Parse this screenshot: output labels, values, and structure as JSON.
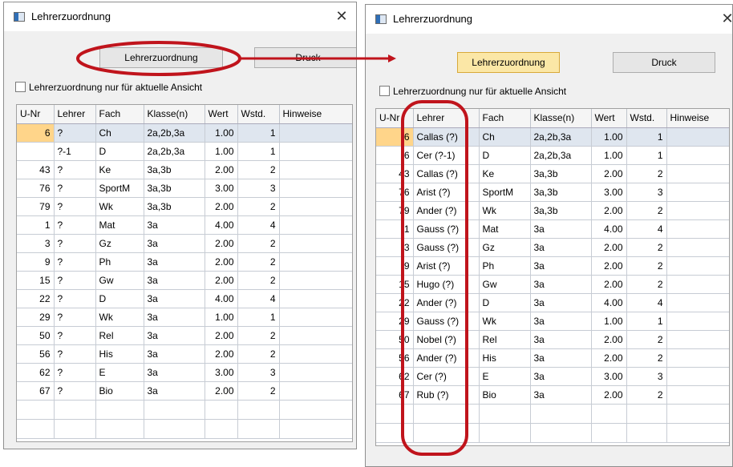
{
  "colors": {
    "accent_red": "#c0141c",
    "button_highlight": "#fbe7a6",
    "selected_row": "#dfe6ef",
    "selected_cell": "#ffd58a"
  },
  "left": {
    "title": "Lehrerzuordnung",
    "close": "✕",
    "buttons": {
      "assign": "Lehrerzuordnung",
      "print": "Druck"
    },
    "checkbox_label": "Lehrerzuordnung nur für aktuelle Ansicht",
    "columns": [
      "U-Nr",
      "Lehrer",
      "Fach",
      "Klasse(n)",
      "Wert",
      "Wstd.",
      "Hinweise"
    ],
    "rows": [
      [
        "6",
        "?",
        "Ch",
        "2a,2b,3a",
        "1.00",
        "1",
        ""
      ],
      [
        "",
        "?-1",
        "D",
        "2a,2b,3a",
        "1.00",
        "1",
        ""
      ],
      [
        "43",
        "?",
        "Ke",
        "3a,3b",
        "2.00",
        "2",
        ""
      ],
      [
        "76",
        "?",
        "SportM",
        "3a,3b",
        "3.00",
        "3",
        ""
      ],
      [
        "79",
        "?",
        "Wk",
        "3a,3b",
        "2.00",
        "2",
        ""
      ],
      [
        "1",
        "?",
        "Mat",
        "3a",
        "4.00",
        "4",
        ""
      ],
      [
        "3",
        "?",
        "Gz",
        "3a",
        "2.00",
        "2",
        ""
      ],
      [
        "9",
        "?",
        "Ph",
        "3a",
        "2.00",
        "2",
        ""
      ],
      [
        "15",
        "?",
        "Gw",
        "3a",
        "2.00",
        "2",
        ""
      ],
      [
        "22",
        "?",
        "D",
        "3a",
        "4.00",
        "4",
        ""
      ],
      [
        "29",
        "?",
        "Wk",
        "3a",
        "1.00",
        "1",
        ""
      ],
      [
        "50",
        "?",
        "Rel",
        "3a",
        "2.00",
        "2",
        ""
      ],
      [
        "56",
        "?",
        "His",
        "3a",
        "2.00",
        "2",
        ""
      ],
      [
        "62",
        "?",
        "E",
        "3a",
        "3.00",
        "3",
        ""
      ],
      [
        "67",
        "?",
        "Bio",
        "3a",
        "2.00",
        "2",
        ""
      ]
    ]
  },
  "right": {
    "title": "Lehrerzuordnung",
    "close": "✕",
    "buttons": {
      "assign": "Lehrerzuordnung",
      "print": "Druck"
    },
    "checkbox_label": "Lehrerzuordnung nur für aktuelle Ansicht",
    "columns": [
      "U-Nr",
      "Lehrer",
      "Fach",
      "Klasse(n)",
      "Wert",
      "Wstd.",
      "Hinweise"
    ],
    "rows": [
      [
        "6",
        "Callas (?)",
        "Ch",
        "2a,2b,3a",
        "1.00",
        "1",
        ""
      ],
      [
        "6",
        "Cer (?-1)",
        "D",
        "2a,2b,3a",
        "1.00",
        "1",
        ""
      ],
      [
        "43",
        "Callas (?)",
        "Ke",
        "3a,3b",
        "2.00",
        "2",
        ""
      ],
      [
        "76",
        "Arist (?)",
        "SportM",
        "3a,3b",
        "3.00",
        "3",
        ""
      ],
      [
        "79",
        "Ander (?)",
        "Wk",
        "3a,3b",
        "2.00",
        "2",
        ""
      ],
      [
        "1",
        "Gauss (?)",
        "Mat",
        "3a",
        "4.00",
        "4",
        ""
      ],
      [
        "3",
        "Gauss (?)",
        "Gz",
        "3a",
        "2.00",
        "2",
        ""
      ],
      [
        "9",
        "Arist (?)",
        "Ph",
        "3a",
        "2.00",
        "2",
        ""
      ],
      [
        "15",
        "Hugo (?)",
        "Gw",
        "3a",
        "2.00",
        "2",
        ""
      ],
      [
        "22",
        "Ander (?)",
        "D",
        "3a",
        "4.00",
        "4",
        ""
      ],
      [
        "29",
        "Gauss (?)",
        "Wk",
        "3a",
        "1.00",
        "1",
        ""
      ],
      [
        "50",
        "Nobel (?)",
        "Rel",
        "3a",
        "2.00",
        "2",
        ""
      ],
      [
        "56",
        "Ander (?)",
        "His",
        "3a",
        "2.00",
        "2",
        ""
      ],
      [
        "62",
        "Cer (?)",
        "E",
        "3a",
        "3.00",
        "3",
        ""
      ],
      [
        "67",
        "Rub (?)",
        "Bio",
        "3a",
        "2.00",
        "2",
        ""
      ]
    ]
  }
}
